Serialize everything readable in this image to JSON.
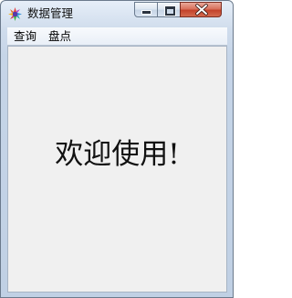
{
  "window": {
    "title": "数据管理",
    "controls": {
      "minimize": "minimize-icon",
      "maximize": "maximize-icon",
      "close": "close-icon"
    }
  },
  "menu": {
    "items": [
      {
        "label": "查询"
      },
      {
        "label": "盘点"
      }
    ]
  },
  "main": {
    "welcome_text": "欢迎使用!"
  },
  "colors": {
    "close_button": "#c4432b",
    "client_bg": "#f0f0f0"
  }
}
